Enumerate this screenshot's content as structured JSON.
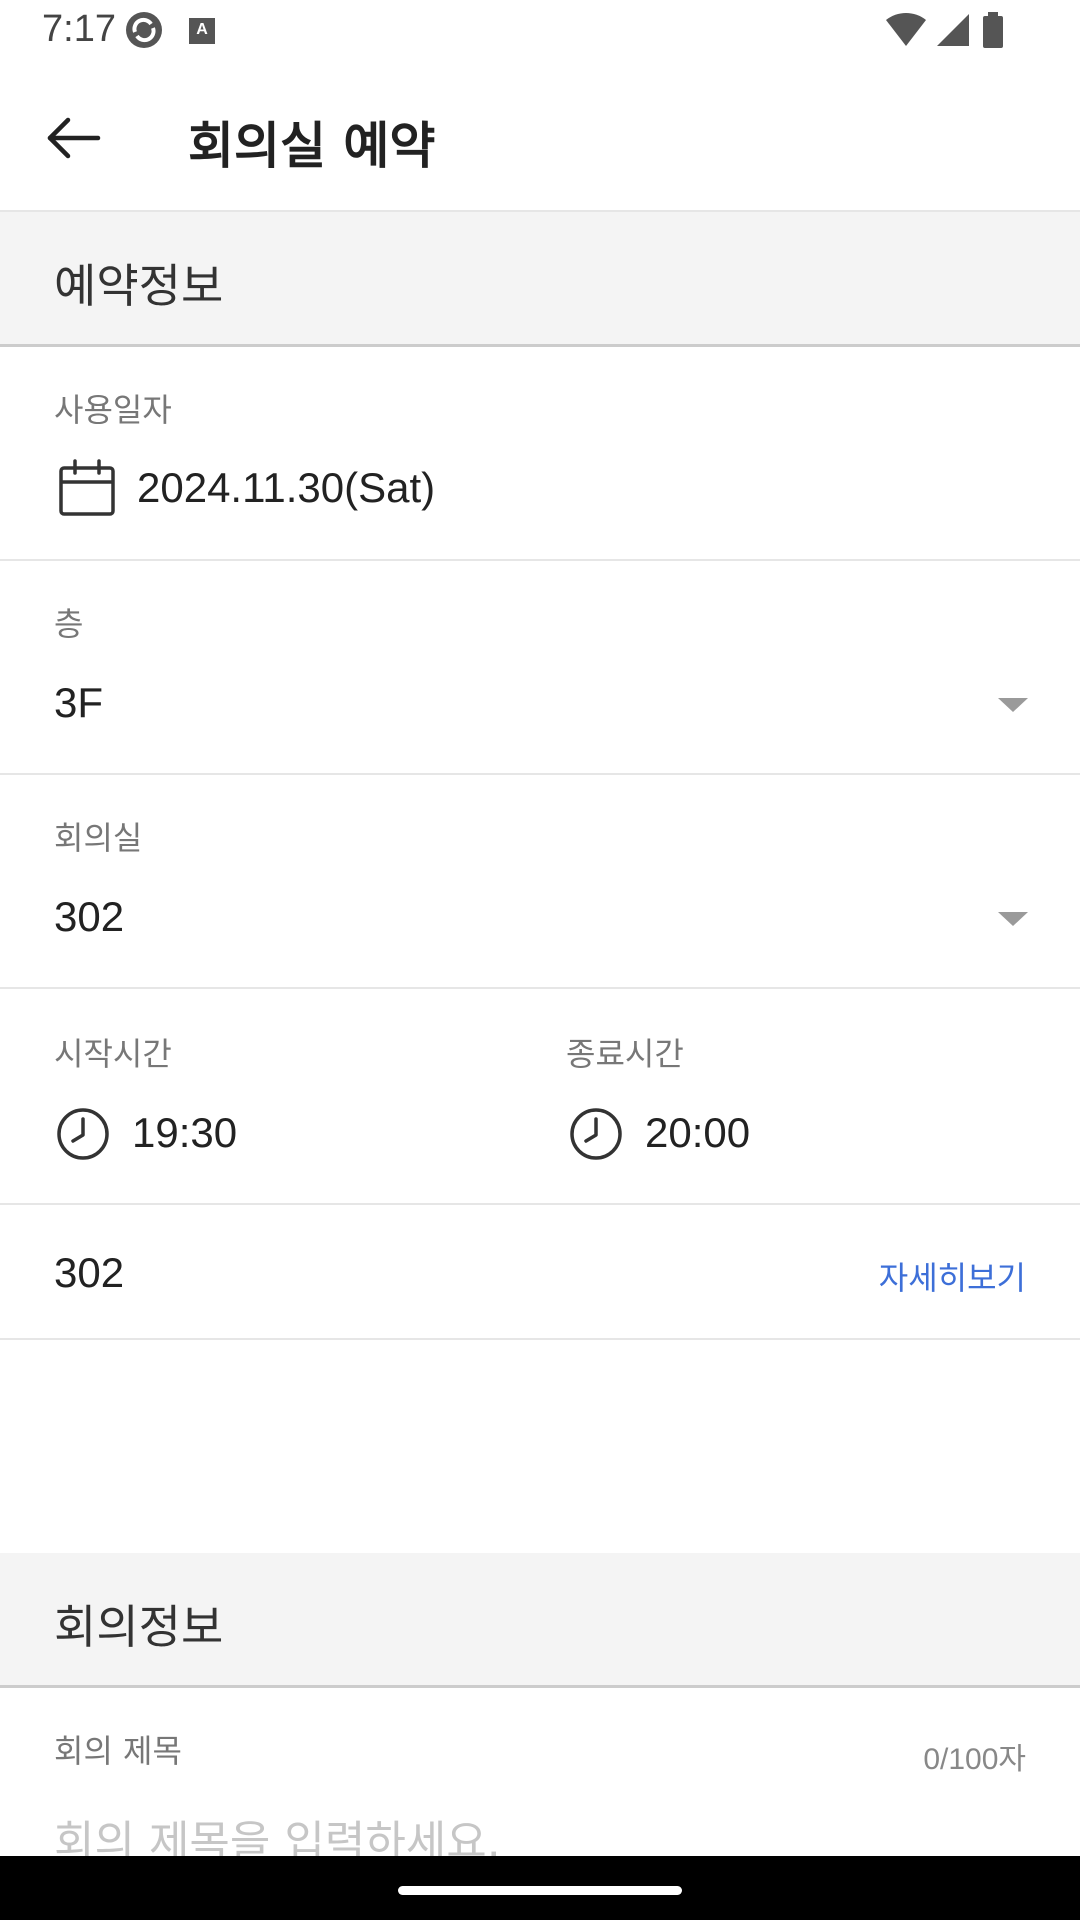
{
  "status_bar": {
    "time": "7:17",
    "icons": [
      "sync-app-icon",
      "text-app-icon",
      "wifi-icon",
      "signal-icon",
      "battery-icon"
    ],
    "text_icon_letter": "A"
  },
  "header": {
    "title": "회의실 예약",
    "back_icon": "arrow-left-icon"
  },
  "reservation_section": {
    "title": "예약정보"
  },
  "date_row": {
    "label": "사용일자",
    "value": "2024.11.30(Sat)",
    "icon": "calendar-icon"
  },
  "floor_row": {
    "label": "층",
    "value": "3F"
  },
  "room_row": {
    "label": "회의실",
    "value": "302"
  },
  "time_row": {
    "start_label": "시작시간",
    "start_value": "19:30",
    "end_label": "종료시간",
    "end_value": "20:00",
    "icon": "clock-icon"
  },
  "room_detail_row": {
    "room": "302",
    "link": "자세히보기"
  },
  "meeting_section": {
    "title": "회의정보"
  },
  "meeting_title_row": {
    "label": "회의 제목",
    "counter": "0/100자",
    "placeholder": "회의 제목을 입력하세요."
  },
  "colors": {
    "link": "#3d6fd8",
    "section_bg": "#f4f4f4",
    "divider": "#e6e6e6"
  }
}
